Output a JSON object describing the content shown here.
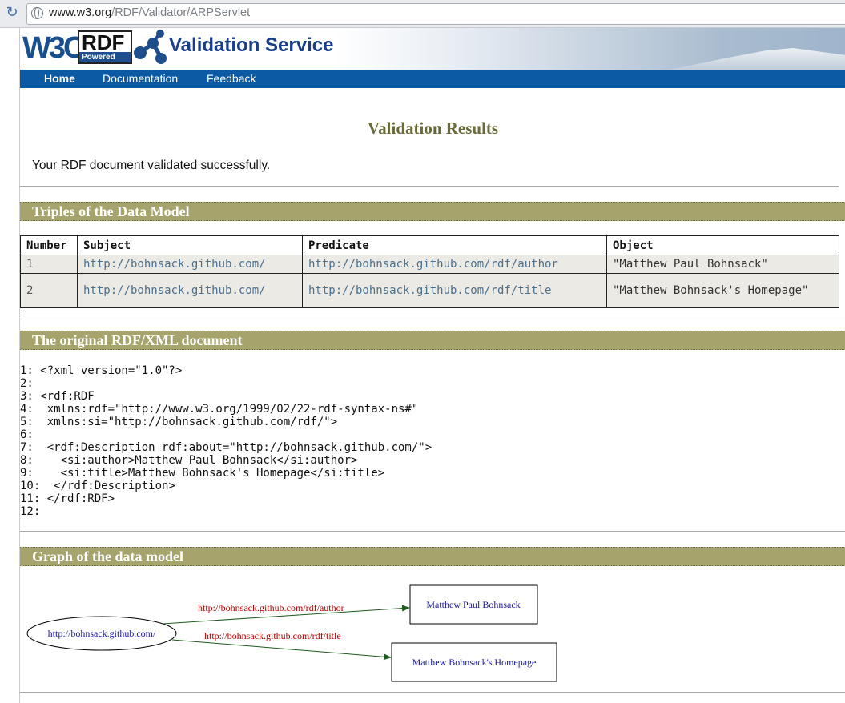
{
  "browser": {
    "url_host": "www.w3.org",
    "url_path": "/RDF/Validator/ARPServlet"
  },
  "banner": {
    "w3c_logo": "W3C",
    "rdf_logo": "RDF",
    "rdf_powered": "Powered",
    "title": "Validation Service"
  },
  "nav": {
    "items": [
      "Home",
      "Documentation",
      "Feedback"
    ],
    "active": "Home"
  },
  "results": {
    "title": "Validation Results",
    "message": "Your RDF document validated successfully."
  },
  "triples": {
    "heading": "Triples of the Data Model",
    "columns": [
      "Number",
      "Subject",
      "Predicate",
      "Object"
    ],
    "rows": [
      {
        "number": "1",
        "subject": "http://bohnsack.github.com/",
        "predicate": "http://bohnsack.github.com/rdf/author",
        "object": "\"Matthew Paul Bohnsack\""
      },
      {
        "number": "2",
        "subject": "http://bohnsack.github.com/",
        "predicate": "http://bohnsack.github.com/rdf/title",
        "object": "\"Matthew Bohnsack's Homepage\""
      }
    ]
  },
  "original": {
    "heading": "The original RDF/XML document",
    "lines": [
      "1: <?xml version=\"1.0\"?>",
      "2:",
      "3: <rdf:RDF",
      "4:  xmlns:rdf=\"http://www.w3.org/1999/02/22-rdf-syntax-ns#\"",
      "5:  xmlns:si=\"http://bohnsack.github.com/rdf/\">",
      "6:",
      "7:  <rdf:Description rdf:about=\"http://bohnsack.github.com/\">",
      "8:    <si:author>Matthew Paul Bohnsack</si:author>",
      "9:    <si:title>Matthew Bohnsack's Homepage</si:title>",
      "10:  </rdf:Description>",
      "11: </rdf:RDF>",
      "12:"
    ]
  },
  "graph": {
    "heading": "Graph of the data model",
    "subject_node": "http://bohnsack.github.com/",
    "edges": [
      {
        "label": "http://bohnsack.github.com/rdf/author",
        "target": "Matthew Paul Bohnsack"
      },
      {
        "label": "http://bohnsack.github.com/rdf/title",
        "target": "Matthew Bohnsack's Homepage"
      }
    ],
    "colors": {
      "edge": "#1d5c1d",
      "edge_label": "#b00000",
      "node_text": "#1a1aa0"
    }
  }
}
